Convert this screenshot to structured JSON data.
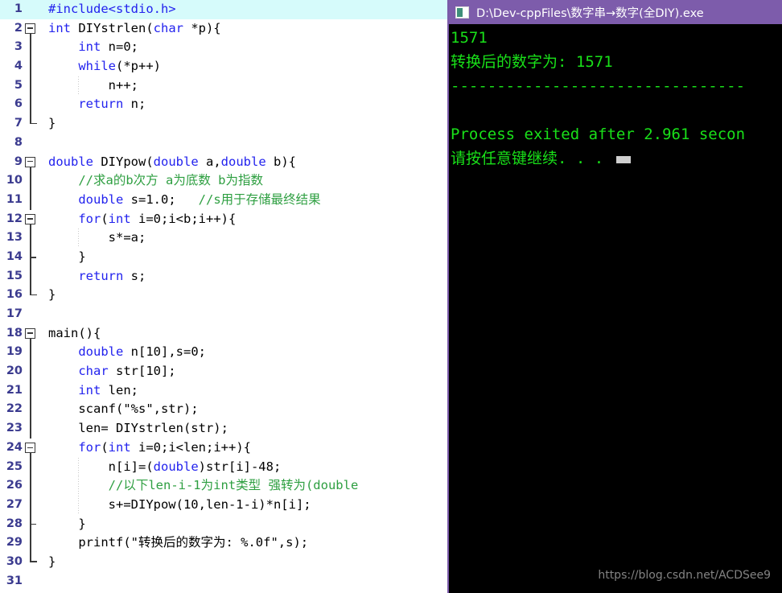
{
  "editor": {
    "name": "code-editor",
    "language": "c",
    "current_line": 1,
    "total_lines": 31,
    "colors": {
      "background": "#ffffff",
      "keyword": "#2222ee",
      "comment": "#2e9f41",
      "plain": "#000000",
      "line_number": "#3b3b8f",
      "current_line_highlight": "#d6fbfb"
    },
    "lines": [
      {
        "n": "1",
        "indent": 0,
        "fold": "none",
        "tokens": [
          {
            "t": "pre",
            "s": "#include<stdio.h>"
          }
        ]
      },
      {
        "n": "2",
        "indent": 0,
        "fold": "start",
        "tokens": [
          {
            "t": "kw",
            "s": "int"
          },
          {
            "t": "pl",
            "s": " DIYstrlen("
          },
          {
            "t": "kw",
            "s": "char"
          },
          {
            "t": "pl",
            "s": " *p){"
          }
        ]
      },
      {
        "n": "3",
        "indent": 0,
        "fold": "body",
        "tokens": [
          {
            "t": "pl",
            "s": "    "
          },
          {
            "t": "kw",
            "s": "int"
          },
          {
            "t": "pl",
            "s": " n=0;"
          }
        ]
      },
      {
        "n": "4",
        "indent": 0,
        "fold": "body",
        "tokens": [
          {
            "t": "pl",
            "s": "    "
          },
          {
            "t": "kw",
            "s": "while"
          },
          {
            "t": "pl",
            "s": "(*p++)"
          }
        ]
      },
      {
        "n": "5",
        "indent": 1,
        "fold": "body",
        "tokens": [
          {
            "t": "pl",
            "s": "        n++;"
          }
        ]
      },
      {
        "n": "6",
        "indent": 0,
        "fold": "body",
        "tokens": [
          {
            "t": "pl",
            "s": "    "
          },
          {
            "t": "kw",
            "s": "return"
          },
          {
            "t": "pl",
            "s": " n;"
          }
        ]
      },
      {
        "n": "7",
        "indent": 0,
        "fold": "end",
        "tokens": [
          {
            "t": "pl",
            "s": "}"
          }
        ]
      },
      {
        "n": "8",
        "indent": 0,
        "fold": "none",
        "tokens": [
          {
            "t": "pl",
            "s": ""
          }
        ]
      },
      {
        "n": "9",
        "indent": 0,
        "fold": "start",
        "tokens": [
          {
            "t": "kw",
            "s": "double"
          },
          {
            "t": "pl",
            "s": " DIYpow("
          },
          {
            "t": "kw",
            "s": "double"
          },
          {
            "t": "pl",
            "s": " a,"
          },
          {
            "t": "kw",
            "s": "double"
          },
          {
            "t": "pl",
            "s": " b){"
          }
        ]
      },
      {
        "n": "10",
        "indent": 0,
        "fold": "body",
        "tokens": [
          {
            "t": "pl",
            "s": "    "
          },
          {
            "t": "cmt",
            "s": "//求a的b次方 a为底数 b为指数"
          }
        ]
      },
      {
        "n": "11",
        "indent": 0,
        "fold": "body",
        "tokens": [
          {
            "t": "pl",
            "s": "    "
          },
          {
            "t": "kw",
            "s": "double"
          },
          {
            "t": "pl",
            "s": " s=1.0;   "
          },
          {
            "t": "cmt",
            "s": "//s用于存储最终结果"
          }
        ]
      },
      {
        "n": "12",
        "indent": 0,
        "fold": "start2",
        "tokens": [
          {
            "t": "pl",
            "s": "    "
          },
          {
            "t": "kw",
            "s": "for"
          },
          {
            "t": "pl",
            "s": "("
          },
          {
            "t": "kw",
            "s": "int"
          },
          {
            "t": "pl",
            "s": " i=0;i<b;i++){"
          }
        ]
      },
      {
        "n": "13",
        "indent": 1,
        "fold": "body",
        "tokens": [
          {
            "t": "pl",
            "s": "        s*=a;"
          }
        ]
      },
      {
        "n": "14",
        "indent": 0,
        "fold": "mid",
        "tokens": [
          {
            "t": "pl",
            "s": "    }"
          }
        ]
      },
      {
        "n": "15",
        "indent": 0,
        "fold": "body",
        "tokens": [
          {
            "t": "pl",
            "s": "    "
          },
          {
            "t": "kw",
            "s": "return"
          },
          {
            "t": "pl",
            "s": " s;"
          }
        ]
      },
      {
        "n": "16",
        "indent": 0,
        "fold": "end",
        "tokens": [
          {
            "t": "pl",
            "s": "}"
          }
        ]
      },
      {
        "n": "17",
        "indent": 0,
        "fold": "none",
        "tokens": [
          {
            "t": "pl",
            "s": ""
          }
        ]
      },
      {
        "n": "18",
        "indent": 0,
        "fold": "start",
        "tokens": [
          {
            "t": "pl",
            "s": "main(){"
          }
        ]
      },
      {
        "n": "19",
        "indent": 0,
        "fold": "body",
        "tokens": [
          {
            "t": "pl",
            "s": "    "
          },
          {
            "t": "kw",
            "s": "double"
          },
          {
            "t": "pl",
            "s": " n[10],s=0;"
          }
        ]
      },
      {
        "n": "20",
        "indent": 0,
        "fold": "body",
        "tokens": [
          {
            "t": "pl",
            "s": "    "
          },
          {
            "t": "kw",
            "s": "char"
          },
          {
            "t": "pl",
            "s": " str[10];"
          }
        ]
      },
      {
        "n": "21",
        "indent": 0,
        "fold": "body",
        "tokens": [
          {
            "t": "pl",
            "s": "    "
          },
          {
            "t": "kw",
            "s": "int"
          },
          {
            "t": "pl",
            "s": " len;"
          }
        ]
      },
      {
        "n": "22",
        "indent": 0,
        "fold": "body",
        "tokens": [
          {
            "t": "pl",
            "s": "    scanf(\"%s\",str);"
          }
        ]
      },
      {
        "n": "23",
        "indent": 0,
        "fold": "body",
        "tokens": [
          {
            "t": "pl",
            "s": "    len= DIYstrlen(str);"
          }
        ]
      },
      {
        "n": "24",
        "indent": 0,
        "fold": "start2",
        "tokens": [
          {
            "t": "pl",
            "s": "    "
          },
          {
            "t": "kw",
            "s": "for"
          },
          {
            "t": "pl",
            "s": "("
          },
          {
            "t": "kw",
            "s": "int"
          },
          {
            "t": "pl",
            "s": " i=0;i<len;i++){"
          }
        ]
      },
      {
        "n": "25",
        "indent": 1,
        "fold": "body",
        "tokens": [
          {
            "t": "pl",
            "s": "        n[i]=("
          },
          {
            "t": "kw",
            "s": "double"
          },
          {
            "t": "pl",
            "s": ")str[i]-48;"
          }
        ]
      },
      {
        "n": "26",
        "indent": 1,
        "fold": "body",
        "tokens": [
          {
            "t": "pl",
            "s": "        "
          },
          {
            "t": "cmt",
            "s": "//以下len-i-1为int类型 强转为(double"
          }
        ]
      },
      {
        "n": "27",
        "indent": 1,
        "fold": "body",
        "tokens": [
          {
            "t": "pl",
            "s": "        s+=DIYpow(10,len-1-i)*n[i];"
          }
        ]
      },
      {
        "n": "28",
        "indent": 0,
        "fold": "mid",
        "tokens": [
          {
            "t": "pl",
            "s": "    }"
          }
        ]
      },
      {
        "n": "29",
        "indent": 0,
        "fold": "body",
        "tokens": [
          {
            "t": "pl",
            "s": "    printf(\"转换后的数字为: %.0f\",s);"
          }
        ]
      },
      {
        "n": "30",
        "indent": 0,
        "fold": "end",
        "tokens": [
          {
            "t": "pl",
            "s": "}"
          }
        ]
      },
      {
        "n": "31",
        "indent": 0,
        "fold": "none",
        "tokens": [
          {
            "t": "pl",
            "s": ""
          }
        ]
      }
    ]
  },
  "console": {
    "titlebar": {
      "title": "D:\\Dev-cppFiles\\数字串→数字(全DIY).exe",
      "icon": "console-window-icon",
      "background": "#7d5cab",
      "text_color": "#ffffff"
    },
    "text_color": "#19e019",
    "background": "#000000",
    "output_lines": [
      "1571",
      "转换后的数字为: 1571",
      "--------------------------------",
      "",
      "Process exited after 2.961 secon",
      "请按任意键继续. . ."
    ]
  },
  "watermark": {
    "text": "https://blog.csdn.net/ACDSee9"
  }
}
